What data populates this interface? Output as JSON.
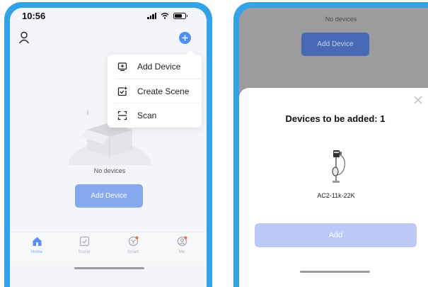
{
  "left_screen": {
    "status_bar": {
      "time": "10:56"
    },
    "empty_state": {
      "text": "No devices",
      "button_label": "Add Device"
    },
    "dropdown_menu": {
      "items": [
        {
          "label": "Add Device",
          "icon": "add-device-icon"
        },
        {
          "label": "Create Scene",
          "icon": "create-scene-icon"
        },
        {
          "label": "Scan",
          "icon": "scan-icon"
        }
      ]
    },
    "tab_bar": {
      "tabs": [
        {
          "label": "Home",
          "icon": "home-icon",
          "active": true
        },
        {
          "label": "Scene",
          "icon": "scene-icon",
          "active": false
        },
        {
          "label": "Smart",
          "icon": "smart-icon",
          "active": false
        },
        {
          "label": "Me",
          "icon": "me-icon",
          "active": false
        }
      ]
    }
  },
  "right_screen": {
    "background": {
      "text": "No devices",
      "button_label": "Add Device"
    },
    "sheet": {
      "title": "Devices to be added: 1",
      "device_name": "AC2-11k-22K",
      "button_label": "Add"
    }
  },
  "colors": {
    "accent": "#4f8ef5",
    "phone_frame": "#33a3e8",
    "button": "#86a8ef",
    "sheet_button": "#bcc9f7"
  }
}
